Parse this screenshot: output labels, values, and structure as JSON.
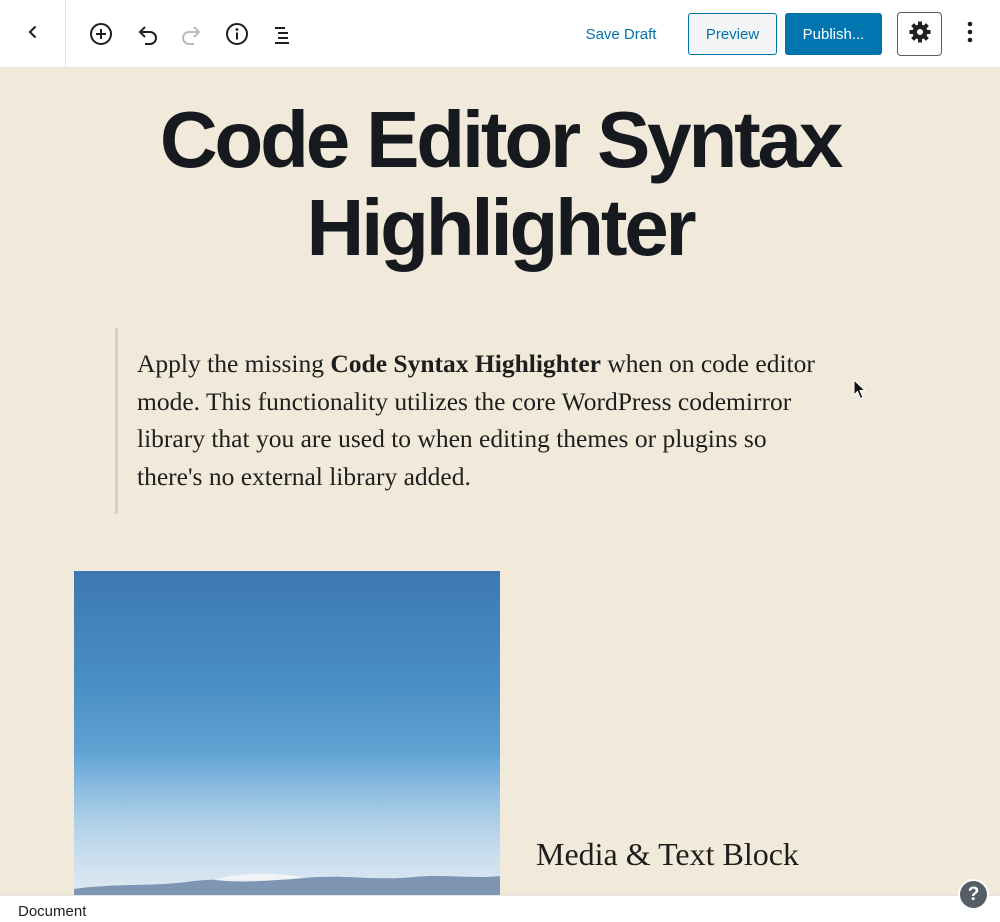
{
  "toolbar": {
    "back_icon": "chevron-left-icon",
    "add_block_icon": "plus-circle-icon",
    "undo_icon": "undo-icon",
    "redo_icon": "redo-icon",
    "info_icon": "info-icon",
    "outline_icon": "list-view-icon",
    "save_draft_label": "Save Draft",
    "preview_label": "Preview",
    "publish_label": "Publish...",
    "settings_icon": "gear-icon",
    "more_icon": "vertical-ellipsis-icon",
    "accent_color": "#0073aa",
    "publish_color": "#0075af"
  },
  "post": {
    "title_line1": "Code Editor Syntax",
    "title_line2": "Highlighter",
    "quote_before": "Apply the missing ",
    "quote_bold": "Code Syntax Highlighter",
    "quote_after": " when on code editor mode. This functionality utilizes the core WordPress codemirror library that you are used to when editing themes or plugins so there's no external library added.",
    "media_image_desc": "sky-photo",
    "media_text": "Media & Text Block",
    "background_color": "#f1e9da"
  },
  "footer": {
    "breadcrumb": "Document",
    "help_label": "?"
  }
}
